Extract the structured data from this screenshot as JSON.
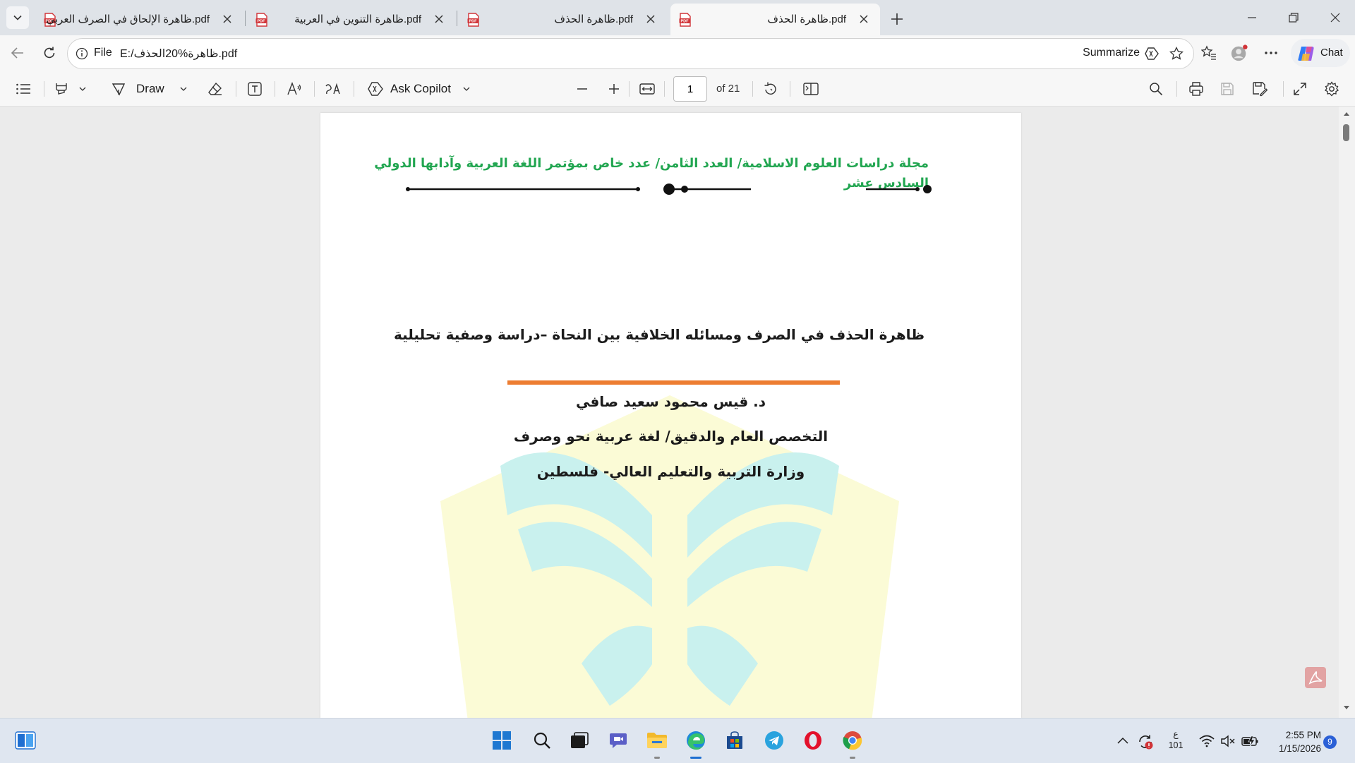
{
  "tabs": [
    {
      "title": "ظاهرة الإلحاق في الصرف العربي.pdf",
      "active": false
    },
    {
      "title": "ظاهرة التنوين في العربية.pdf",
      "active": false
    },
    {
      "title": "ظاهرة الحذف.pdf",
      "active": false
    },
    {
      "title": "ظاهرة الحذف.pdf",
      "active": true
    }
  ],
  "address_bar": {
    "scheme_label": "File",
    "url": "E:/ظاهرة%20الحذف.pdf",
    "summarize_label": "Summarize"
  },
  "chat_button": {
    "label": "Chat"
  },
  "pdf_toolbar": {
    "draw_label": "Draw",
    "ask_copilot_label": "Ask Copilot",
    "page_number": "1",
    "page_total_label": "of 21"
  },
  "document": {
    "journal_header": "مجلة دراسات العلوم الاسلامية/ العدد الثامن/ عدد خاص بمؤتمر اللغة العربية وآدابها الدولي السادس عشر",
    "title": "ظاهرة الحذف في الصرف ومسائله الخلافية بين النحاة –دراسة وصفية تحليلية",
    "author": "د. قيس محمود سعيد صافي",
    "specialization": "التخصص العام والدقيق/ لغة عربية نحو وصرف",
    "affiliation": "وزارة التربية والتعليم العالي- فلسطين"
  },
  "taskbar": {
    "language_line1": "ع",
    "language_line2": "101",
    "time": "2:55 PM",
    "date": "1/15/2026",
    "notification_count": "9"
  },
  "colors": {
    "journal_header": "#22a651",
    "title_rule": "#ed7d31",
    "tab_strip": "#dfe3e8",
    "taskbar": "#dfe6f0"
  }
}
